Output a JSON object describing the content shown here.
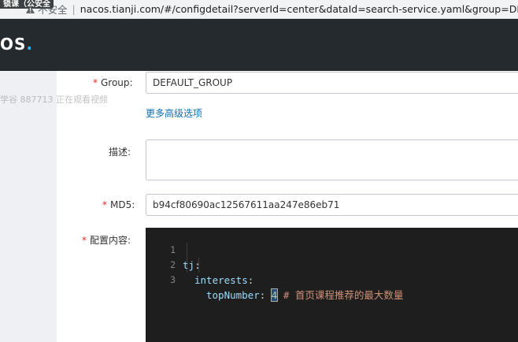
{
  "browser": {
    "tab_fragment": "锁课（公安全",
    "security_label": "不安全",
    "separator": "|",
    "url": "nacos.tianji.com/#/configdetail?serverId=center&dataId=search-service.yaml&group=DEFAU"
  },
  "navbar": {
    "logo_text": "OS",
    "logo_dot": "."
  },
  "watermark": {
    "text": "学谷 887713 正在观看视频"
  },
  "form": {
    "group": {
      "required_mark": "*",
      "label": "Group:",
      "value": "DEFAULT_GROUP"
    },
    "advanced_link": "更多高级选项",
    "description": {
      "label": "描述:",
      "value": ""
    },
    "md5": {
      "required_mark": "*",
      "label": "MD5:",
      "value": "b94cf80690ac12567611aa247e86eb71"
    },
    "content": {
      "required_mark": "*",
      "label": "配置内容:"
    }
  },
  "editor": {
    "line_numbers": [
      "1",
      "2",
      "3"
    ],
    "line1": {
      "key": "tj",
      "colon": ":"
    },
    "line2": {
      "key": "interests",
      "colon": ":"
    },
    "line3": {
      "key": "topNumber",
      "colon": ":",
      "value": "4",
      "comment": "# 首页课程推荐的最大数量"
    }
  },
  "colors": {
    "navbar_bg": "#252a2f",
    "logo_accent": "#2fb8f5",
    "editor_bg": "#1e1e1e",
    "link": "#0b6fb3",
    "required": "#e62828"
  }
}
